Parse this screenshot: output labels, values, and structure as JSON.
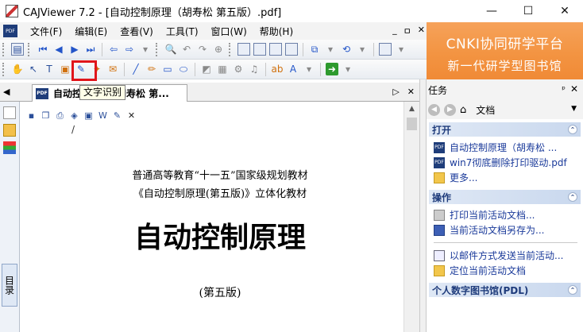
{
  "window": {
    "title": "CAJViewer 7.2 - [自动控制原理（胡寿松 第五版）.pdf]",
    "minimize": "—",
    "maximize": "☐",
    "close": "✕"
  },
  "banner": {
    "line1": "CNKI协同研学平台",
    "line2": "新一代研学型图书馆"
  },
  "menu": {
    "items": [
      "文件(F)",
      "编辑(E)",
      "查看(V)",
      "工具(T)",
      "窗口(W)",
      "帮助(H)"
    ],
    "mdi_restore": "ㅁ",
    "mdi_close": "✕",
    "pdf_icon": "PDF"
  },
  "tooltip": {
    "text": "文字识别"
  },
  "tab": {
    "label": "自动控",
    "label_suffix": "胡寿松 第...",
    "icon": "PDF",
    "prev": "◀",
    "next": "▷",
    "close": "✕"
  },
  "left_strip": {
    "tab_label": "目录"
  },
  "document": {
    "line1": "普通高等教育“十一五”国家级规划教材",
    "line2": "《自动控制原理(第五版)》立体化教材",
    "title": "自动控制原理",
    "edition": "(第五版)",
    "mark": "/"
  },
  "taskpane": {
    "title": "任务",
    "pin": "ᵖ",
    "close": "✕",
    "nav_label": "文档",
    "sections": [
      {
        "heading": "打开",
        "links": [
          {
            "icon": "pdf-icon",
            "text": "自动控制原理（胡寿松 ..."
          },
          {
            "icon": "pdf-icon",
            "text": "win7彻底删除打印驱动.pdf"
          },
          {
            "icon": "folder-icon",
            "text": "更多..."
          }
        ]
      },
      {
        "heading": "操作",
        "links": [
          {
            "icon": "printer-icon",
            "text": "打印当前活动文档..."
          },
          {
            "icon": "save-icon",
            "text": "当前活动文档另存为..."
          },
          {
            "icon": "mail-icon",
            "text": "以邮件方式发送当前活动..."
          },
          {
            "icon": "folder-icon",
            "text": "定位当前活动文档"
          }
        ]
      },
      {
        "heading": "个人数字图书馆(PDL)",
        "links": []
      }
    ]
  },
  "colors": {
    "banner": "#f39442",
    "highlight": "#e0151b",
    "section_heading": "#1f3c7c"
  }
}
